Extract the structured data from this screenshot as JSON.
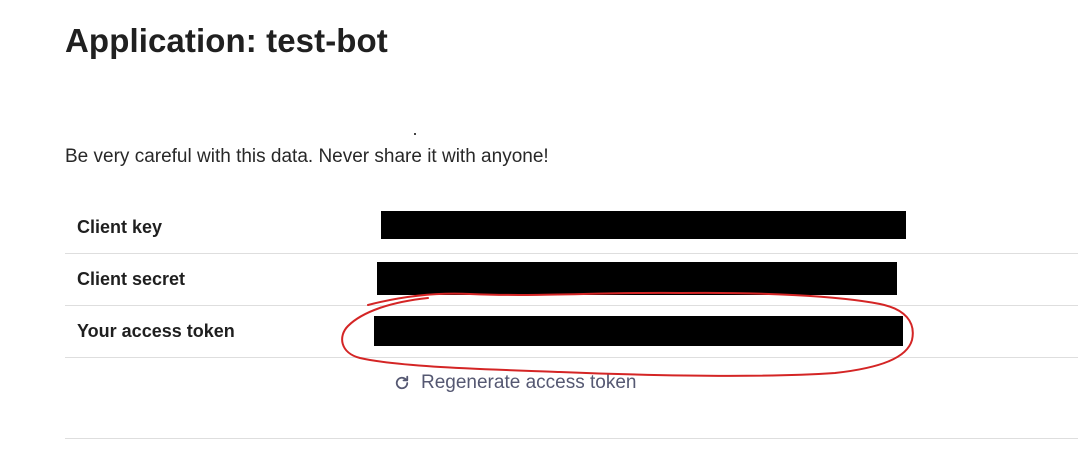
{
  "page": {
    "title": "Application: test-bot",
    "warning": "Be very careful with this data. Never share it with anyone!"
  },
  "credentials": [
    {
      "label": "Client key",
      "value": "",
      "redacted": true
    },
    {
      "label": "Client secret",
      "value": "",
      "redacted": true
    },
    {
      "label": "Your access token",
      "value": "",
      "redacted": true
    }
  ],
  "regenerate": {
    "label": "Regenerate access token",
    "icon": "refresh-icon"
  },
  "colors": {
    "redaction": "#000000",
    "annotation": "#d42525",
    "link": "#555872",
    "divider": "#dedede"
  }
}
